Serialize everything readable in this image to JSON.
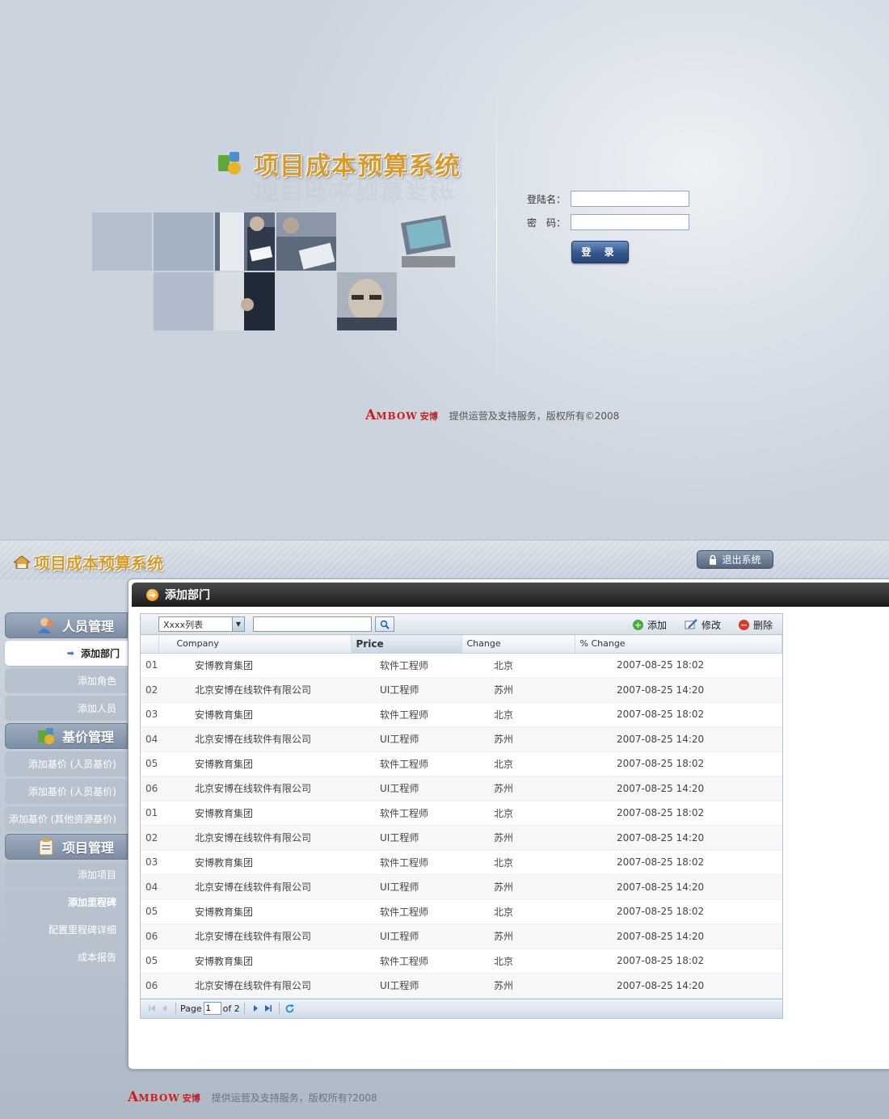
{
  "login": {
    "system_title": "项目成本预算系统",
    "username_label": "登陆名：",
    "password_label": "密　码：",
    "username_value": "",
    "password_value": "",
    "login_button": "登 录",
    "footer_brand_a": "A",
    "footer_brand_rest": "MBOW",
    "footer_brand_cn": "安博",
    "footer_text": "提供运营及支持服务，版权所有©2008"
  },
  "app": {
    "title": "项目成本预算系统",
    "logout_label": "退出系统",
    "sidebar": {
      "groups": [
        {
          "title": "人员管理",
          "icon": "user-manage-icon",
          "items": [
            {
              "label": "添加部门",
              "active": true
            },
            {
              "label": "添加角色"
            },
            {
              "label": "添加人员"
            }
          ]
        },
        {
          "title": "基价管理",
          "icon": "price-manage-icon",
          "items": [
            {
              "label": "添加基价 (人员基价)"
            },
            {
              "label": "添加基价 (人员基价)"
            },
            {
              "label": "添加基价 (其他资源基价)"
            }
          ]
        },
        {
          "title": "项目管理",
          "icon": "project-manage-icon",
          "items": [
            {
              "label": "添加项目"
            },
            {
              "label": "添加里程碑",
              "bold": true
            },
            {
              "label": "配置里程碑详细"
            },
            {
              "label": "成本报告"
            }
          ]
        }
      ]
    },
    "panel_title": "添加部门",
    "toolbar": {
      "select_value": "Xxxx列表",
      "search_value": "",
      "add_label": "添加",
      "edit_label": "修改",
      "delete_label": "删除"
    },
    "table": {
      "columns": [
        "Company",
        "Price",
        "Change",
        "% Change"
      ],
      "rows": [
        [
          "01",
          "安博教育集团",
          "软件工程师",
          "北京",
          "2007-08-25 18:02"
        ],
        [
          "02",
          "北京安博在线软件有限公司",
          "UI工程师",
          "苏州",
          "2007-08-25 14:20"
        ],
        [
          "03",
          "安博教育集团",
          "软件工程师",
          "北京",
          "2007-08-25 18:02"
        ],
        [
          "04",
          "北京安博在线软件有限公司",
          "UI工程师",
          "苏州",
          "2007-08-25 14:20"
        ],
        [
          "05",
          "安博教育集团",
          "软件工程师",
          "北京",
          "2007-08-25 18:02"
        ],
        [
          "06",
          "北京安博在线软件有限公司",
          "UI工程师",
          "苏州",
          "2007-08-25 14:20"
        ],
        [
          "01",
          "安博教育集团",
          "软件工程师",
          "北京",
          "2007-08-25 18:02"
        ],
        [
          "02",
          "北京安博在线软件有限公司",
          "UI工程师",
          "苏州",
          "2007-08-25 14:20"
        ],
        [
          "03",
          "安博教育集团",
          "软件工程师",
          "北京",
          "2007-08-25 18:02"
        ],
        [
          "04",
          "北京安博在线软件有限公司",
          "UI工程师",
          "苏州",
          "2007-08-25 14:20"
        ],
        [
          "05",
          "安博教育集团",
          "软件工程师",
          "北京",
          "2007-08-25 18:02"
        ],
        [
          "06",
          "北京安博在线软件有限公司",
          "UI工程师",
          "苏州",
          "2007-08-25 14:20"
        ],
        [
          "05",
          "安博教育集团",
          "软件工程师",
          "北京",
          "2007-08-25 18:02"
        ],
        [
          "06",
          "北京安博在线软件有限公司",
          "UI工程师",
          "苏州",
          "2007-08-25 14:20"
        ]
      ]
    },
    "pager": {
      "page_label": "Page",
      "page_value": "1",
      "of_label": "of 2"
    },
    "footer_brand_a": "A",
    "footer_brand_rest": "MBOW",
    "footer_brand_cn": "安博",
    "footer_text": "提供运营及支持服务，版权所有?2008"
  }
}
